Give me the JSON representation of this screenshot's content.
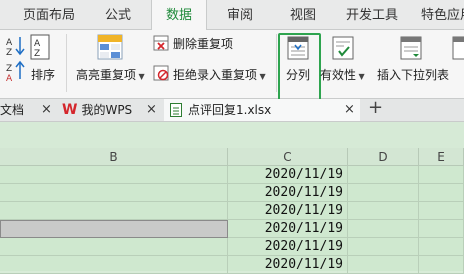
{
  "ribbon_tabs": [
    {
      "label": "页面布局",
      "active": false
    },
    {
      "label": "公式",
      "active": false
    },
    {
      "label": "数据",
      "active": true
    },
    {
      "label": "审阅",
      "active": false
    },
    {
      "label": "视图",
      "active": false
    },
    {
      "label": "开发工具",
      "active": false
    },
    {
      "label": "特色应用",
      "active": false
    }
  ],
  "toolbar": {
    "sort_label": "排序",
    "highlight_dup_label": "高亮重复项",
    "remove_dup_label": "删除重复项",
    "reject_dup_label": "拒绝录入重复项",
    "split_label": "分列",
    "validity_label": "有效性",
    "insert_dropdown_label": "插入下拉列表"
  },
  "doc_tabs": [
    {
      "label": "文档"
    },
    {
      "label": "我的WPS"
    },
    {
      "label": "点评回复1.xlsx",
      "active": true
    }
  ],
  "add_tab_label": "+",
  "close_glyph": "×",
  "columns": [
    "B",
    "C",
    "D",
    "E"
  ],
  "rows": [
    {
      "c": "2020/11/19",
      "b_selected": false
    },
    {
      "c": "2020/11/19",
      "b_selected": false
    },
    {
      "c": "2020/11/19",
      "b_selected": false
    },
    {
      "c": "2020/11/19",
      "b_selected": true
    },
    {
      "c": "2020/11/19",
      "b_selected": false
    },
    {
      "c": "2020/11/19",
      "b_selected": false
    }
  ],
  "colors": {
    "accent": "#1f8a3a",
    "highlight_border": "#2ea44f",
    "grid_bg": "#cfe8cf",
    "selected_cell": "#c9cac9",
    "wps_red": "#d4262c"
  }
}
